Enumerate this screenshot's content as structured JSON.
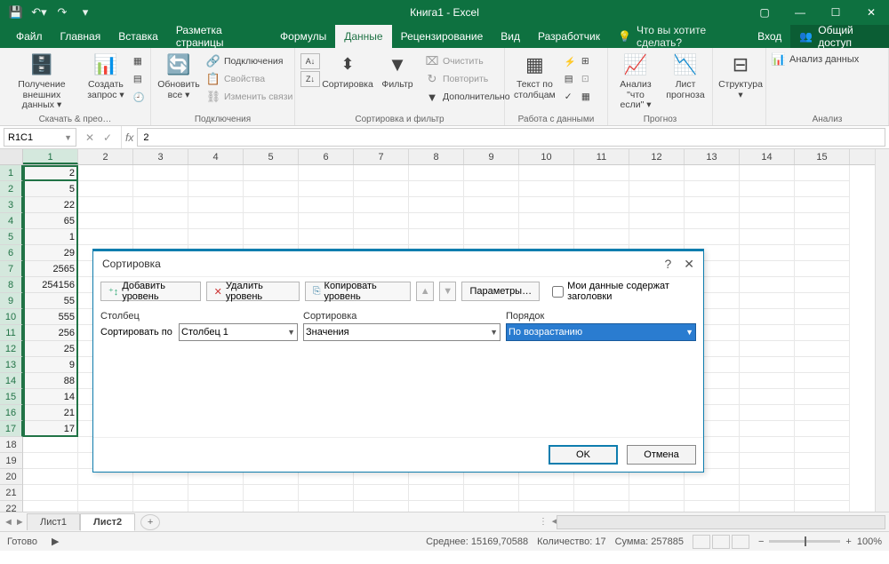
{
  "app": {
    "title": "Книга1 - Excel"
  },
  "qat": {
    "save": "💾",
    "undo": "↶",
    "redo": "↷"
  },
  "window": {
    "login": "Вход",
    "share": "Общий доступ"
  },
  "menu": {
    "file": "Файл",
    "tabs": [
      "Главная",
      "Вставка",
      "Разметка страницы",
      "Формулы",
      "Данные",
      "Рецензирование",
      "Вид",
      "Разработчик"
    ],
    "active_index": 4,
    "tell_me": "Что вы хотите сделать?"
  },
  "ribbon": {
    "groups": {
      "get": {
        "title": "Скачать & прео…",
        "btn1": "Получение\nвнешних данных ▾",
        "btn2": "Создать\nзапрос ▾"
      },
      "conn": {
        "title": "Подключения",
        "refresh": "Обновить\nвсе ▾",
        "c1": "Подключения",
        "c2": "Свойства",
        "c3": "Изменить связи"
      },
      "sort": {
        "title": "Сортировка и фильтр",
        "az": "AZ",
        "sortbtn": "Сортировка",
        "filter": "Фильтр",
        "clear": "Очистить",
        "reapply": "Повторить",
        "adv": "Дополнительно"
      },
      "tools": {
        "title": "Работа с данными",
        "text": "Текст по\nстолбцам"
      },
      "forecast": {
        "title": "Прогноз",
        "whatif": "Анализ \"что\nесли\" ▾",
        "sheet": "Лист\nпрогноза"
      },
      "outline": {
        "title": "",
        "btn": "Структура\n▾"
      },
      "analysis": {
        "title": "Анализ",
        "btn": "Анализ данных"
      }
    }
  },
  "formula": {
    "namebox": "R1C1",
    "value": "2"
  },
  "grid": {
    "cols": [
      "1",
      "2",
      "3",
      "4",
      "5",
      "6",
      "7",
      "8",
      "9",
      "10",
      "11",
      "12",
      "13",
      "14",
      "15"
    ],
    "rows_count": 22,
    "selected_rows": 17,
    "data_col1": [
      "2",
      "5",
      "22",
      "65",
      "1",
      "29",
      "2565",
      "254156",
      "55",
      "555",
      "256",
      "25",
      "9",
      "88",
      "14",
      "21",
      "17"
    ]
  },
  "sheets": {
    "tabs": [
      "Лист1",
      "Лист2"
    ],
    "active": 1
  },
  "status": {
    "ready": "Готово",
    "avg_label": "Среднее:",
    "avg": "15169,70588",
    "count_label": "Количество:",
    "count": "17",
    "sum_label": "Сумма:",
    "sum": "257885",
    "zoom": "100%"
  },
  "dialog": {
    "title": "Сортировка",
    "add": "Добавить уровень",
    "del": "Удалить уровень",
    "copy": "Копировать уровень",
    "params": "Параметры…",
    "headers_chk": "Мои данные содержат заголовки",
    "col_h": "Столбец",
    "sort_h": "Сортировка",
    "order_h": "Порядок",
    "sortby": "Сортировать по",
    "col_val": "Столбец 1",
    "sort_val": "Значения",
    "order_val": "По возрастанию",
    "ok": "OK",
    "cancel": "Отмена"
  }
}
